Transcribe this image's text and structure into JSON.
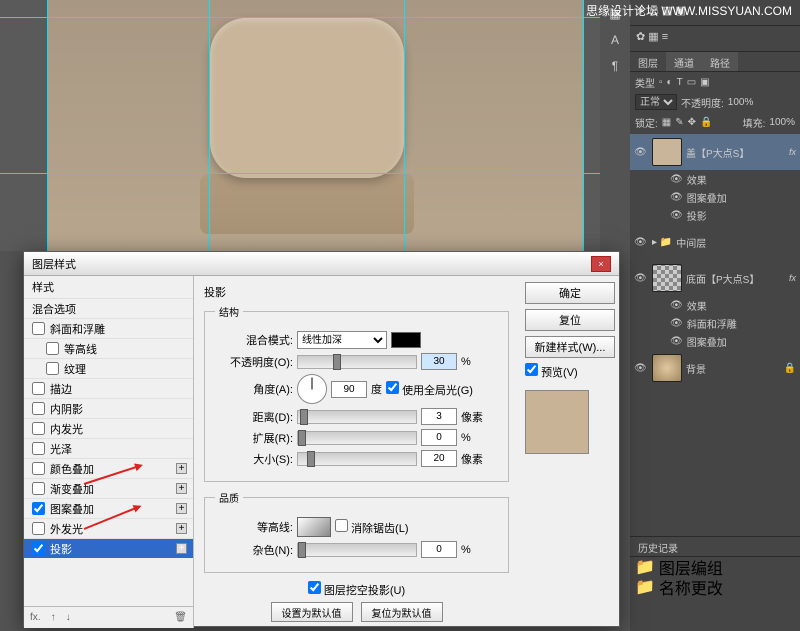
{
  "watermark": "思缘设计论坛 WWW.MISSYUAN.COM",
  "panels": {
    "layers_tab": "图层",
    "channels_tab": "通道",
    "paths_tab": "路径",
    "kind": "类型",
    "blend_mode": "正常",
    "opacity_label": "不透明度:",
    "opacity_val": "100%",
    "lock_label": "锁定:",
    "fill_label": "填充:",
    "fill_val": "100%"
  },
  "layers": [
    {
      "name": "盖【P大点S】",
      "fx": true,
      "effects": [
        "效果",
        "图案叠加",
        "投影"
      ]
    },
    {
      "name": "中间层",
      "folder": true
    },
    {
      "name": "底面【P大点S】",
      "fx": true,
      "effects": [
        "效果",
        "斜面和浮雕",
        "图案叠加"
      ]
    },
    {
      "name": "背景",
      "locked": true
    }
  ],
  "history": {
    "title": "历史记录",
    "items": [
      "图层编组",
      "名称更改"
    ]
  },
  "dialog": {
    "title": "图层样式",
    "close": "×",
    "styles_header": "样式",
    "blend_options": "混合选项",
    "style_items": [
      {
        "label": "斜面和浮雕",
        "checked": false
      },
      {
        "label": "等高线",
        "checked": false,
        "indent": true
      },
      {
        "label": "纹理",
        "checked": false,
        "indent": true
      },
      {
        "label": "描边",
        "checked": false
      },
      {
        "label": "内阴影",
        "checked": false
      },
      {
        "label": "内发光",
        "checked": false
      },
      {
        "label": "光泽",
        "checked": false
      },
      {
        "label": "颜色叠加",
        "checked": false
      },
      {
        "label": "渐变叠加",
        "checked": false
      },
      {
        "label": "图案叠加",
        "checked": true
      },
      {
        "label": "外发光",
        "checked": false
      },
      {
        "label": "投影",
        "checked": true,
        "selected": true
      }
    ],
    "section_title": "投影",
    "structure_title": "结构",
    "blend_mode_label": "混合模式:",
    "blend_mode_value": "线性加深",
    "opacity_label": "不透明度(O):",
    "opacity_value": "30",
    "percent": "%",
    "angle_label": "角度(A):",
    "angle_value": "90",
    "angle_unit": "度",
    "global_light": "使用全局光(G)",
    "distance_label": "距离(D):",
    "distance_value": "3",
    "px": "像素",
    "spread_label": "扩展(R):",
    "spread_value": "0",
    "size_label": "大小(S):",
    "size_value": "20",
    "quality_title": "品质",
    "contour_label": "等高线:",
    "antialias_label": "消除锯齿(L)",
    "noise_label": "杂色(N):",
    "noise_value": "0",
    "knockout_label": "图层挖空投影(U)",
    "make_default": "设置为默认值",
    "reset_default": "复位为默认值",
    "ok": "确定",
    "cancel": "复位",
    "new_style": "新建样式(W)...",
    "preview": "预览(V)"
  }
}
